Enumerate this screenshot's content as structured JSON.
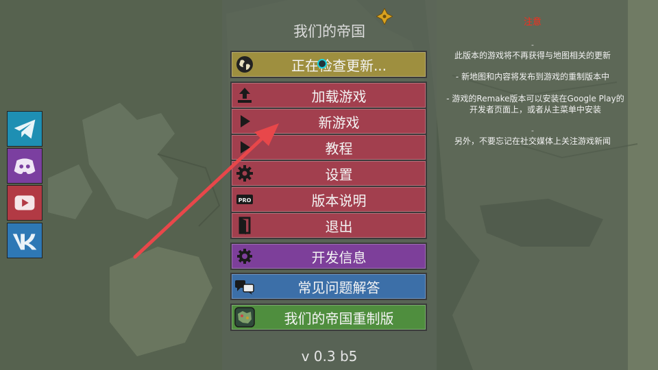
{
  "menu": {
    "title": "我们的帝国",
    "version": "v 0.3 b5",
    "buttons": [
      {
        "label": "正在检查更新...",
        "icon": "globe-icon",
        "color": "#9e8f3f"
      },
      {
        "label": "加载游戏",
        "icon": "upload-icon",
        "color": "#a23f4e"
      },
      {
        "label": "新游戏",
        "icon": "play-icon",
        "color": "#a23f4e"
      },
      {
        "label": "教程",
        "icon": "play-icon",
        "color": "#a23f4e"
      },
      {
        "label": "设置",
        "icon": "gear-icon",
        "color": "#a23f4e"
      },
      {
        "label": "版本说明",
        "icon": "pro-badge-icon",
        "color": "#a23f4e"
      },
      {
        "label": "退出",
        "icon": "exit-door-icon",
        "color": "#a23f4e"
      },
      {
        "label": "开发信息",
        "icon": "gear-code-icon",
        "color": "#7d3f9a"
      },
      {
        "label": "常见问题解答",
        "icon": "chat-bubbles-icon",
        "color": "#3c6fa8"
      },
      {
        "label": "我们的帝国重制版",
        "icon": "remake-map-icon",
        "color": "#4f8e3e"
      }
    ]
  },
  "social": [
    {
      "name": "telegram",
      "icon": "telegram-icon",
      "color": "#1e8fb3"
    },
    {
      "name": "discord",
      "icon": "discord-icon",
      "color": "#7b3fa0"
    },
    {
      "name": "youtube",
      "icon": "youtube-icon",
      "color": "#b23a44"
    },
    {
      "name": "vk",
      "icon": "vk-icon",
      "color": "#2e78b5"
    }
  ],
  "notice": {
    "title": "注意",
    "dash": "-",
    "p1": "此版本的游戏将不再获得与地图相关的更新",
    "p2": "- 新地图和内容将发布到游戏的重制版本中",
    "p3": "- 游戏的Remake版本可以安装在Google Play的开发者页面上，或者从主菜单中安装",
    "p4": "另外，不要忘记在社交媒体上关注游戏新闻"
  },
  "colors": {
    "accent_red": "#ff2a1a",
    "arrow": "#e8474a"
  }
}
